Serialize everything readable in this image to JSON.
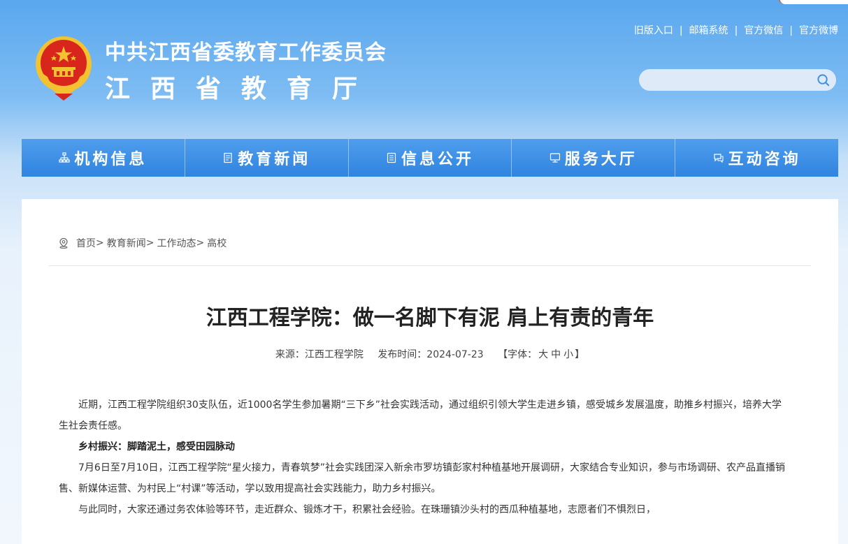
{
  "header": {
    "title_top": "中共江西省委教育工作委员会",
    "title_bottom": "江西省教育厅",
    "top_links": [
      "旧版入口",
      "邮箱系统",
      "官方微信",
      "官方微博"
    ],
    "search_placeholder": ""
  },
  "nav": {
    "items": [
      {
        "label": "机构信息",
        "icon": "org-chart-icon"
      },
      {
        "label": "教育新闻",
        "icon": "document-icon"
      },
      {
        "label": "信息公开",
        "icon": "list-document-icon"
      },
      {
        "label": "服务大厅",
        "icon": "monitor-icon"
      },
      {
        "label": "互动咨询",
        "icon": "chat-icon"
      }
    ]
  },
  "breadcrumb": {
    "items": [
      "首页",
      "教育新闻",
      "工作动态",
      "高校"
    ],
    "separator": ">"
  },
  "article": {
    "title": "江西工程学院：做一名脚下有泥 肩上有责的青年",
    "source": "来源：江西工程学院",
    "publish_time": "发布时间：2024-07-23",
    "font_ctrl_prefix": "【字体：",
    "font_large": "大",
    "font_medium": "中",
    "font_small": "小",
    "font_ctrl_suffix": "】",
    "paragraphs": [
      {
        "type": "text",
        "text": "近期，江西工程学院组织30支队伍，近1000名学生参加暑期“三下乡”社会实践活动，通过组织引领大学生走进乡镇，感受城乡发展温度，助推乡村振兴，培养大学生社会责任感。"
      },
      {
        "type": "subhead",
        "text": "乡村振兴：脚踏泥土，感受田园脉动"
      },
      {
        "type": "text",
        "text": "7月6日至7月10日，江西工程学院“星火接力，青春筑梦”社会实践团深入新余市罗坊镇彭家村种植基地开展调研，大家结合专业知识，参与市场调研、农产品直播销售、新媒体运营、为村民上“村课”等活动，学以致用提高社会实践能力，助力乡村振兴。"
      },
      {
        "type": "text",
        "text": "与此同时，大家还通过务农体验等环节，走近群众、锻炼才干，积累社会经验。在珠珊镇沙头村的西瓜种植基地，志愿者们不惧烈日，"
      }
    ]
  },
  "colors": {
    "nav_bg": "#3b8fe6",
    "header_bg": "#5aa7ee",
    "emblem_red": "#d8261c",
    "emblem_gold": "#f2c230"
  }
}
